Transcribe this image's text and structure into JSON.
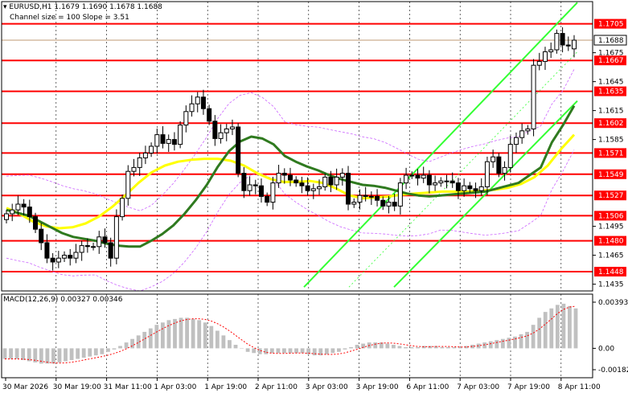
{
  "header": {
    "symbol_line": "EURUSD,H1  1.1679 1.1690 1.1678 1.1688",
    "channel_line": "Channel size = 100 Slope = 3.51"
  },
  "macd": {
    "label": "MACD(12,26,9) 0.00327 0.00346",
    "axis_labels": [
      "0.00393",
      "0.00",
      "-0.00182"
    ]
  },
  "colors": {
    "level_line": "#ff0000",
    "candle": "#000000",
    "ma_fast": "#2f7a1f",
    "ma_slow": "#ffff00",
    "channel": "#33ff33",
    "bollinger": "#cc66ff",
    "macd_hist": "#c0c0c0",
    "macd_signal": "#ff0000",
    "grid": "#000000"
  },
  "chart_data": {
    "type": "candlestick",
    "symbol": "EURUSD",
    "timeframe": "H1",
    "ohlc_current": {
      "open": 1.1679,
      "high": 1.169,
      "low": 1.1678,
      "close": 1.1688
    },
    "current_price": "1.1688",
    "y_axis_ticks": [
      "1.1675",
      "1.1645",
      "1.1615",
      "1.1585",
      "1.1495",
      "1.1465",
      "1.1435"
    ],
    "levels": [
      "1.1705",
      "1.1667",
      "1.1635",
      "1.1602",
      "1.1571",
      "1.1549",
      "1.1527",
      "1.1506",
      "1.1480",
      "1.1448"
    ],
    "x_tick_labels": [
      "30 Mar 2026",
      "30 Mar 19:00",
      "31 Mar 11:00",
      "1 Apr 03:00",
      "1 Apr 19:00",
      "2 Apr 11:00",
      "3 Apr 03:00",
      "3 Apr 19:00",
      "6 Apr 11:00",
      "7 Apr 03:00",
      "7 Apr 19:00",
      "8 Apr 11:00"
    ],
    "ylim": [
      1.1428,
      1.1728
    ],
    "series": [
      {
        "indicator": "candles",
        "close": [
          1.1508,
          1.1512,
          1.1518,
          1.1515,
          1.1505,
          1.1492,
          1.1478,
          1.1462,
          1.1458,
          1.1462,
          1.1465,
          1.1462,
          1.1468,
          1.1475,
          1.1474,
          1.1474,
          1.1484,
          1.1478,
          1.1462,
          1.1505,
          1.1524,
          1.1552,
          1.1556,
          1.1566,
          1.1571,
          1.1578,
          1.159,
          1.1581,
          1.1585,
          1.158,
          1.16,
          1.1614,
          1.1622,
          1.1629,
          1.1617,
          1.1604,
          1.1586,
          1.1592,
          1.1596,
          1.1598,
          1.155,
          1.1532,
          1.1538,
          1.1537,
          1.1526,
          1.152,
          1.154,
          1.155,
          1.1548,
          1.1543,
          1.154,
          1.1537,
          1.1532,
          1.1534,
          1.1536,
          1.1546,
          1.1538,
          1.1546,
          1.155,
          1.1518,
          1.152,
          1.1527,
          1.1526,
          1.1526,
          1.1522,
          1.1516,
          1.152,
          1.1516,
          1.154,
          1.1548,
          1.1548,
          1.1545,
          1.1548,
          1.1538,
          1.154,
          1.1542,
          1.1542,
          1.154,
          1.1532,
          1.1537,
          1.1534,
          1.1532,
          1.1536,
          1.1562,
          1.1567,
          1.155,
          1.1556,
          1.158,
          1.1587,
          1.1594,
          1.1596,
          1.1662,
          1.1666,
          1.1676,
          1.1678,
          1.1695,
          1.1683,
          1.1682,
          1.1688
        ]
      },
      {
        "indicator": "moving-average-fast",
        "values": [
          1.1512,
          1.1509,
          1.1506,
          1.15,
          1.1494,
          1.1488,
          1.1484,
          1.1482,
          1.148,
          1.1477,
          1.1475,
          1.1474,
          1.1474,
          1.148,
          1.1487,
          1.1496,
          1.1508,
          1.1522,
          1.1538,
          1.1557,
          1.1573,
          1.1583,
          1.1588,
          1.1586,
          1.158,
          1.1568,
          1.1562,
          1.1557,
          1.1553,
          1.1548,
          1.1544,
          1.1541,
          1.1538,
          1.1537,
          1.1535,
          1.1532,
          1.1529,
          1.1527,
          1.1526,
          1.1527,
          1.1528,
          1.1529,
          1.153,
          1.1531,
          1.1534,
          1.1537,
          1.154,
          1.1548,
          1.1556,
          1.1582,
          1.16,
          1.162
        ]
      },
      {
        "indicator": "moving-average-slow",
        "values": [
          1.1514,
          1.1508,
          1.15,
          1.1495,
          1.1493,
          1.1494,
          1.1498,
          1.1505,
          1.1515,
          1.1527,
          1.154,
          1.1551,
          1.1558,
          1.1562,
          1.1564,
          1.1565,
          1.1565,
          1.1563,
          1.1558,
          1.155,
          1.1544,
          1.1541,
          1.1541,
          1.1542,
          1.154,
          1.1534,
          1.1527,
          1.1524,
          1.1525,
          1.1526,
          1.1528,
          1.1529,
          1.153,
          1.1531,
          1.1531,
          1.1531,
          1.1532,
          1.1533,
          1.1535,
          1.1539,
          1.1546,
          1.1558,
          1.1575,
          1.159
        ]
      },
      {
        "indicator": "macd-histogram",
        "values": [
          -0.0009,
          -0.0009,
          -0.0009,
          -0.001,
          -0.0011,
          -0.0012,
          -0.0013,
          -0.0013,
          -0.0013,
          -0.0012,
          -0.0011,
          -0.001,
          -0.0009,
          -0.0008,
          -0.0007,
          -0.0006,
          -0.0005,
          -0.0003,
          -0.0001,
          0.0002,
          0.0005,
          0.0008,
          0.0011,
          0.0014,
          0.0017,
          0.002,
          0.0022,
          0.0024,
          0.0025,
          0.0026,
          0.0026,
          0.0025,
          0.0024,
          0.0022,
          0.0019,
          0.0015,
          0.0011,
          0.0007,
          0.0003,
          0.0,
          -0.0003,
          -0.0004,
          -0.0005,
          -0.0005,
          -0.0004,
          -0.0004,
          -0.0004,
          -0.0004,
          -0.0004,
          -0.0004,
          -0.0005,
          -0.0006,
          -0.0006,
          -0.0005,
          -0.0004,
          -0.0003,
          -0.0001,
          0.0001,
          0.0003,
          0.0004,
          0.0005,
          0.0005,
          0.0005,
          0.0004,
          0.0003,
          0.0002,
          0.0001,
          0.0001,
          0.0001,
          0.0002,
          0.0002,
          0.0002,
          0.0001,
          0.0001,
          0.0001,
          0.0001,
          0.0002,
          0.0003,
          0.0004,
          0.0005,
          0.0006,
          0.0007,
          0.0008,
          0.0009,
          0.001,
          0.0012,
          0.0014,
          0.002,
          0.0026,
          0.0031,
          0.0034,
          0.0037,
          0.0038,
          0.0036,
          0.0034
        ]
      }
    ]
  }
}
